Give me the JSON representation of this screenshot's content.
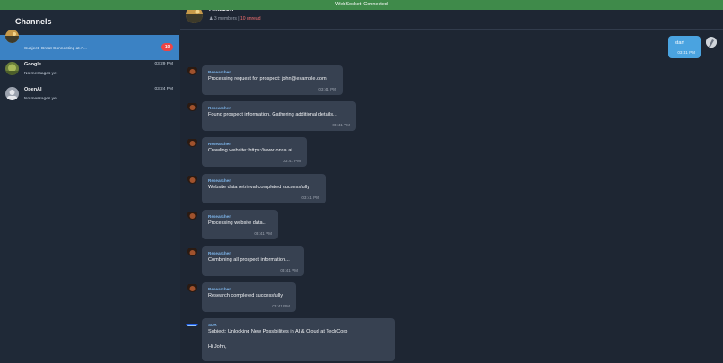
{
  "websocket": {
    "status": "WebSocket: Connected"
  },
  "sidebar": {
    "title": "Channels",
    "channels": [
      {
        "name": "",
        "preview": "Subject: Great Connecting at A...",
        "time": "",
        "badge": "10",
        "active": true
      },
      {
        "name": "Google",
        "preview": "No messages yet",
        "time": "03:29 PM",
        "badge": "",
        "active": false
      },
      {
        "name": "OpenAI",
        "preview": "No messages yet",
        "time": "03:24 PM",
        "badge": "",
        "active": false
      }
    ]
  },
  "chat": {
    "title": "Amazon",
    "members": "3 members",
    "separator": " | ",
    "unread": "10 unread",
    "user_message": {
      "text": "start",
      "time": "03:41 PM"
    },
    "messages": [
      {
        "sender": "Researcher",
        "text": "Processing request for prospect: john@example.com",
        "time": "03:41 PM"
      },
      {
        "sender": "Researcher",
        "text": "Found prospect information. Gathering additional details...",
        "time": "03:41 PM"
      },
      {
        "sender": "Researcher",
        "text": "Crawling website: https://www.onsa.ai",
        "time": "03:41 PM"
      },
      {
        "sender": "Researcher",
        "text": "Website data retrieval completed successfully",
        "time": "03:41 PM"
      },
      {
        "sender": "Researcher",
        "text": "Processing website data...",
        "time": "03:41 PM"
      },
      {
        "sender": "Researcher",
        "text": "Combining all prospect information...",
        "time": "03:41 PM"
      },
      {
        "sender": "Researcher",
        "text": "Research completed successfully",
        "time": "03:41 PM"
      }
    ],
    "sdr_message": {
      "sender": "SDR",
      "subject": "Subject: Unlocking New Possibilities in AI & Cloud at TechCorp",
      "greeting": "Hi John,"
    }
  },
  "colors": {
    "accent": "#3b82c4",
    "badge": "#ef4444",
    "connected": "#3f8a4a",
    "user_bubble": "#4aa3e0"
  }
}
